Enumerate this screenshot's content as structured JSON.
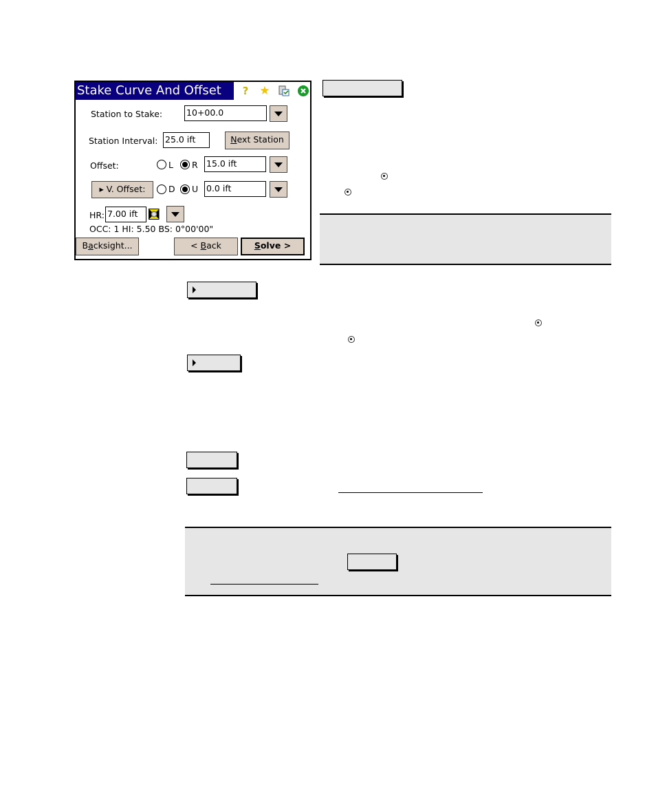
{
  "window": {
    "title": "Stake Curve And Offset",
    "title_icons": [
      "help-icon",
      "favorites-star-icon",
      "clipboard-check-icon",
      "close-icon"
    ],
    "title_bar_color": "#08007f",
    "button_color": "#dccfc4",
    "station_to_stake": {
      "label": "Station to Stake:",
      "value": "10+00.0"
    },
    "station_interval": {
      "label": "Station Interval:",
      "value": "25.0 ift"
    },
    "next_station_button": {
      "mnemonic": "N",
      "rest": "ext Station"
    },
    "offset": {
      "label": "Offset:",
      "options": [
        "L",
        "R"
      ],
      "selected": "R",
      "value": "15.0 ift"
    },
    "v_offset": {
      "button_label": "V. Offset:",
      "options": [
        "D",
        "U"
      ],
      "selected": "U",
      "value": "0.0 ift"
    },
    "hr": {
      "label": "HR:",
      "value": "7.00 ift"
    },
    "status_line": "OCC: 1  HI: 5.50  BS: 0°00'00\"",
    "backsight_button": {
      "pre": "B",
      "mnemonic": "a",
      "rest": "cksight..."
    },
    "back_button": {
      "pre": "< ",
      "mnemonic": "B",
      "rest": "ack"
    },
    "solve_button": {
      "mnemonic": "S",
      "rest": "olve >"
    }
  }
}
